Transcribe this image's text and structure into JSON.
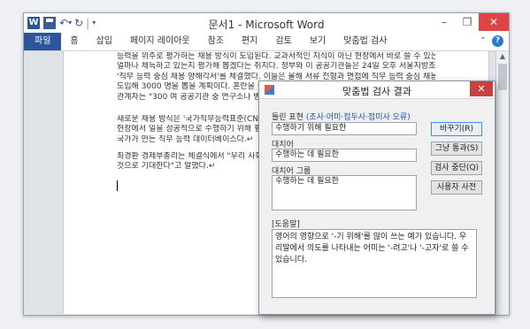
{
  "word": {
    "title": "문서1 - Microsoft Word",
    "window_controls": {
      "minimize": "–",
      "restore": "❐",
      "close": "✕"
    },
    "quick_access": {
      "undo": "↶",
      "redo": "↻",
      "customize": "▾",
      "separator": "|"
    },
    "ribbon_tabs": [
      "파일",
      "홈",
      "삽입",
      "페이지 레이아웃",
      "참조",
      "편지",
      "검토",
      "보기",
      "맞춤법 검사"
    ],
    "ribbon_right": {
      "collapse": "⌃",
      "help": "?"
    },
    "document": {
      "paragraph1": [
        "능력을 위주로 평가하는 채용 방식이 도입된다. 교과서적인 지식이 아닌 현장에서 바로 쓸 수 있는 능력을",
        "얼마나 체득하고 있는지 평가해 뽑겠다는 취지다. 정부와 이 공공기관들은 24일 오후 서울지방조달청에서",
        "'직무 능력 중심 채용 양해각서'를 체결했다. 이들은 올해 서류 전형과 면접에 직무 능력 중심 채용 방식을",
        "도입해 3000 명을 뽑을 계획이다. 혼란을 줄이기 위해 필기시험은 내년부터 단계적으로 바꾸기로 했다. 정부",
        "관계자는 \"300 여 공공기관 중 연구소나 병원 등을 빼"
      ],
      "paragraph2": [
        "새로운 채용 방식은 '국가직무능력표준(CNS·National C",
        "현장에서 일을 성공적으로 수행하기 위해 필요한 지식",
        "국가가 만든 직무 능력 데이터베이스다.↵"
      ],
      "paragraph3": [
        "최경환 경제부총리는 체결식에서 \"우리 사회가 직무 능",
        "것으로 기대한다\"고 말했다.↵"
      ]
    }
  },
  "dialog": {
    "title": "맞춤법 검사 결과",
    "close": "✕",
    "wrong_label": "틀린 표현",
    "wrong_category": "(조사·어미·접두사·접미사 오류)",
    "wrong_value": "수행하기 위해 필요한",
    "replacement_label": "대치어",
    "replacement_value": "수행하는 데 필요한",
    "replacement_group_label": "대치어 그룹",
    "replacement_group_items": [
      "수행하는 데 필요한"
    ],
    "help_label": "[도움말]",
    "help_text": "영어의 영향으로 '-기 위해'를 많이 쓰는 예가 있습니다. 우리말에서 의도를 나타내는 어미는 '-려고'나 '-고자'로 쓸 수 있습니다.",
    "buttons": {
      "change": "바꾸기(R)",
      "skip": "그냥 통과(S)",
      "stop": "검사 중단(Q)",
      "dictionary": "사용자 사전"
    }
  }
}
